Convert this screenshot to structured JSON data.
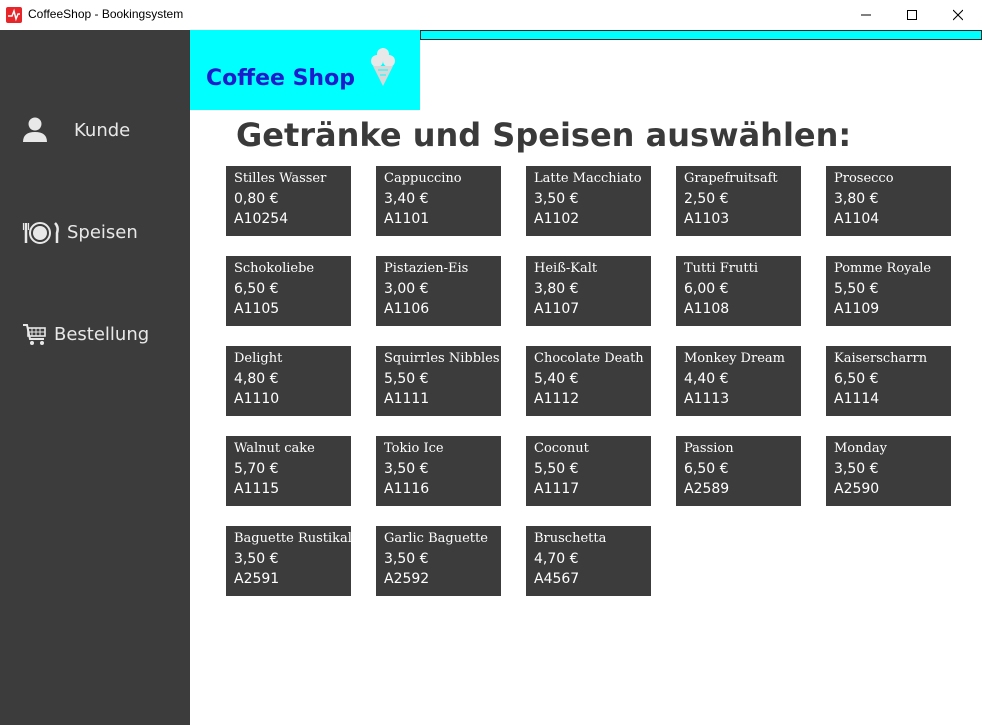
{
  "window": {
    "title": "CoffeeShop - Bookingsystem"
  },
  "sidebar": {
    "items": [
      {
        "label": "Kunde",
        "icon": "user-icon"
      },
      {
        "label": "Speisen",
        "icon": "plate-cutlery-icon"
      },
      {
        "label": "Bestellung",
        "icon": "shopping-cart-icon"
      }
    ]
  },
  "header": {
    "logo_text": "Coffee Shop",
    "logo_icon": "ice-cream-icon"
  },
  "main": {
    "heading": "Getränke und Speisen auswählen:",
    "products": [
      {
        "name": "Stilles Wasser",
        "price": "0,80 €",
        "code": "A10254"
      },
      {
        "name": "Cappuccino",
        "price": "3,40 €",
        "code": "A1101"
      },
      {
        "name": "Latte Macchiato",
        "price": "3,50 €",
        "code": "A1102"
      },
      {
        "name": "Grapefruitsaft",
        "price": "2,50 €",
        "code": "A1103"
      },
      {
        "name": "Prosecco",
        "price": "3,80 €",
        "code": "A1104"
      },
      {
        "name": "Schokoliebe",
        "price": "6,50 €",
        "code": "A1105"
      },
      {
        "name": "Pistazien-Eis",
        "price": "3,00 €",
        "code": "A1106"
      },
      {
        "name": "Heiß-Kalt",
        "price": "3,80 €",
        "code": "A1107"
      },
      {
        "name": "Tutti Frutti",
        "price": "6,00 €",
        "code": "A1108"
      },
      {
        "name": "Pomme Royale",
        "price": "5,50 €",
        "code": "A1109"
      },
      {
        "name": "Delight",
        "price": "4,80 €",
        "code": "A1110"
      },
      {
        "name": "Squirrles Nibbles",
        "price": "5,50 €",
        "code": "A1111"
      },
      {
        "name": "Chocolate Death",
        "price": "5,40 €",
        "code": "A1112"
      },
      {
        "name": "Monkey Dream",
        "price": "4,40 €",
        "code": "A1113"
      },
      {
        "name": "Kaiserscharrn",
        "price": "6,50 €",
        "code": "A1114"
      },
      {
        "name": "Walnut cake",
        "price": "5,70 €",
        "code": "A1115"
      },
      {
        "name": "Tokio Ice",
        "price": "3,50 €",
        "code": "A1116"
      },
      {
        "name": "Coconut",
        "price": "5,50 €",
        "code": "A1117"
      },
      {
        "name": "Passion",
        "price": "6,50 €",
        "code": "A2589"
      },
      {
        "name": "Monday",
        "price": "3,50 €",
        "code": "A2590"
      },
      {
        "name": "Baguette Rustikal",
        "price": "3,50 €",
        "code": "A2591"
      },
      {
        "name": "Garlic Baguette",
        "price": "3,50 €",
        "code": "A2592"
      },
      {
        "name": "Bruschetta",
        "price": "4,70 €",
        "code": "A4567"
      }
    ]
  },
  "colors": {
    "sidebar_bg": "#3c3c3c",
    "tile_bg": "#3c3c3c",
    "logo_bg": "#00ffff",
    "logo_text": "#1c1ccc",
    "heading": "#3a3a3a"
  }
}
